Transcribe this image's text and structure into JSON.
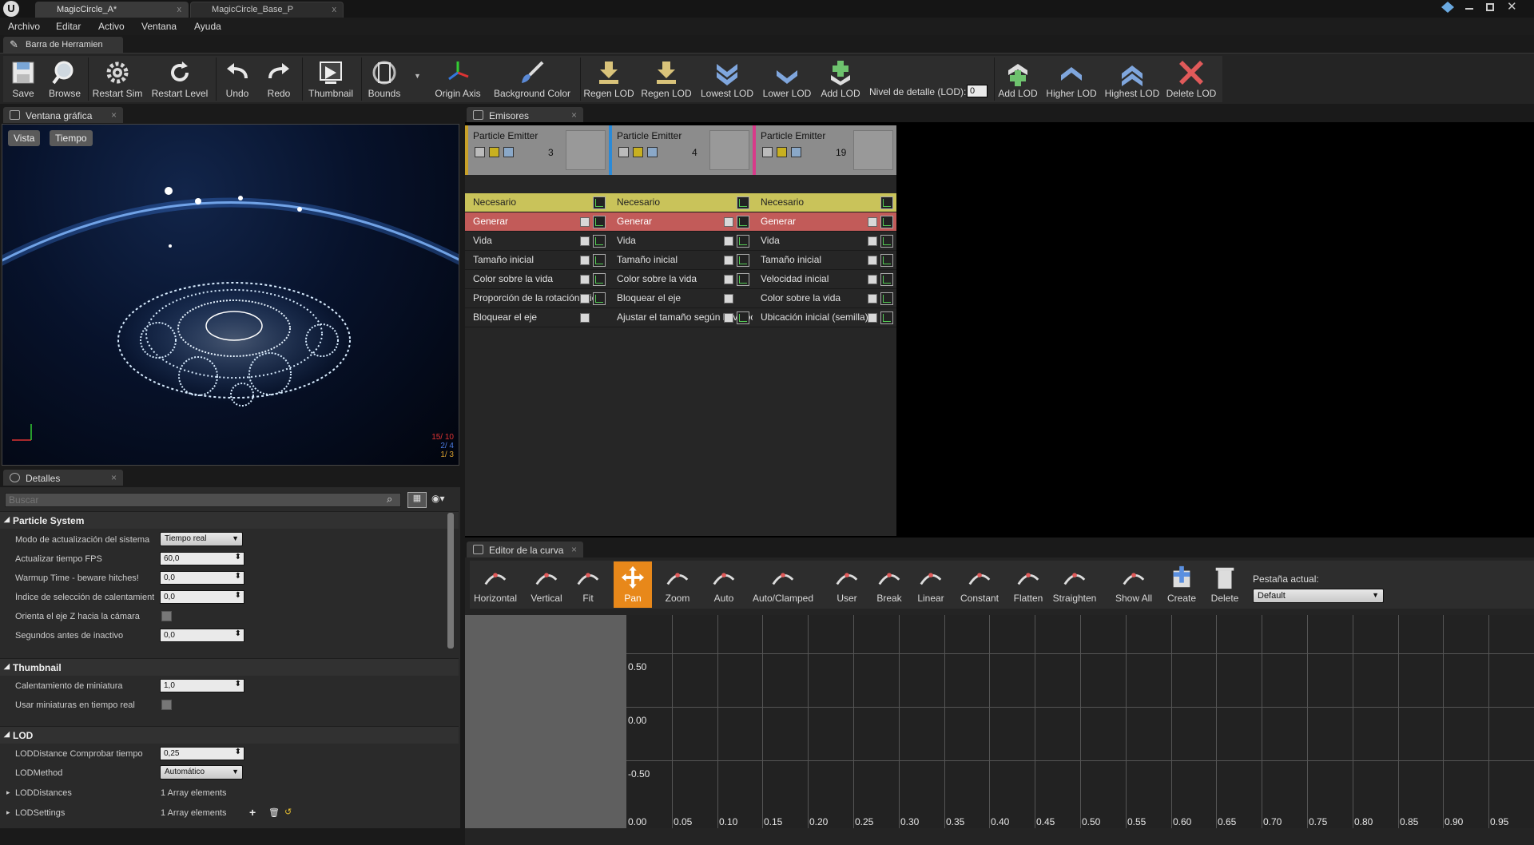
{
  "tabs": [
    {
      "label": "MagicCircle_A*",
      "close": "x"
    },
    {
      "label": "MagicCircle_Base_P",
      "close": "x"
    }
  ],
  "menu": [
    "Archivo",
    "Editar",
    "Activo",
    "Ventana",
    "Ayuda"
  ],
  "tool_tab": "Barra de Herramien",
  "toolbar": {
    "save": "Save",
    "browse": "Browse",
    "restart_sim": "Restart Sim",
    "restart_level": "Restart Level",
    "undo": "Undo",
    "redo": "Redo",
    "thumbnail": "Thumbnail",
    "bounds": "Bounds",
    "origin_axis": "Origin Axis",
    "background_color": "Background Color",
    "regen_lod_1": "Regen LOD",
    "regen_lod_2": "Regen LOD",
    "lowest_lod": "Lowest LOD",
    "lower_lod": "Lower LOD",
    "add_lod_1": "Add LOD",
    "lod_label": "Nivel de detalle (LOD):",
    "lod_value": "0",
    "add_lod_2": "Add LOD",
    "higher_lod": "Higher LOD",
    "highest_lod": "Highest LOD",
    "delete_lod": "Delete LOD"
  },
  "viewport": {
    "tab": "Ventana gráfica",
    "btn_view": "Vista",
    "btn_time": "Tiempo",
    "stats": [
      "15/ 10",
      "2/ 4",
      "1/ 3"
    ]
  },
  "details": {
    "tab": "Detalles",
    "search_placeholder": "Buscar",
    "cat_particle": "Particle System",
    "cat_thumbnail": "Thumbnail",
    "cat_lod": "LOD",
    "rows": {
      "mode_label": "Modo de actualización del sistema",
      "mode_value": "Tiempo real",
      "fps_label": "Actualizar tiempo FPS",
      "fps_value": "60,0",
      "warmup_label": "Warmup Time - beware hitches!",
      "warmup_value": "0,0",
      "warm_sel_label": "Índice de selección de calentamiento",
      "warm_sel_value": "0,0",
      "orient_label": "Orienta el eje Z hacia la cámara",
      "inactive_label": "Segundos antes de inactivo",
      "inactive_value": "0,0",
      "thumb_warm_label": "Calentamiento de miniatura",
      "thumb_warm_value": "1,0",
      "thumb_rt_label": "Usar miniaturas en tiempo real",
      "lod_check_label": "LODDistance Comprobar tiempo",
      "lod_check_value": "0,25",
      "lod_method_label": "LODMethod",
      "lod_method_value": "Automático",
      "lod_distances_label": "LODDistances",
      "lod_distances_value": "1 Array elements",
      "lod_settings_label": "LODSettings",
      "lod_settings_value": "1 Array elements"
    }
  },
  "emitters": {
    "tab": "Emisores",
    "columns": [
      {
        "title": "Particle Emitter",
        "count": "3",
        "color": "#c8a028",
        "modules": [
          "Necesario",
          "Generar",
          "Vida",
          "Tamaño inicial",
          "Color sobre la vida",
          "Proporción de la rotación inicial",
          "Bloquear el eje"
        ]
      },
      {
        "title": "Particle Emitter",
        "count": "4",
        "color": "#2a8ad8",
        "modules": [
          "Necesario",
          "Generar",
          "Vida",
          "Tamaño inicial",
          "Color sobre la vida",
          "Bloquear el eje",
          "Ajustar el tamaño según la velocidad"
        ]
      },
      {
        "title": "Particle Emitter",
        "count": "19",
        "color": "#d83a8a",
        "modules": [
          "Necesario",
          "Generar",
          "Vida",
          "Tamaño inicial",
          "Velocidad inicial",
          "Color sobre la vida",
          "Ubicación inicial (semilla)"
        ]
      }
    ]
  },
  "curve": {
    "tab": "Editor de la curva",
    "tools": [
      "Horizontal",
      "Vertical",
      "Fit",
      "Pan",
      "Zoom",
      "Auto",
      "Auto/Clamped",
      "User",
      "Break",
      "Linear",
      "Constant",
      "Flatten",
      "Straighten",
      "Show All",
      "Create",
      "Delete"
    ],
    "current_tab_label": "Pestaña actual:",
    "current_tab_value": "Default",
    "y_ticks": [
      "0.50",
      "0.00",
      "-0.50"
    ],
    "x_ticks": [
      "0.00",
      "0.05",
      "0.10",
      "0.15",
      "0.20",
      "0.25",
      "0.30",
      "0.35",
      "0.40",
      "0.45",
      "0.50",
      "0.55",
      "0.60",
      "0.65",
      "0.70",
      "0.75",
      "0.80",
      "0.85",
      "0.90",
      "0.95"
    ]
  }
}
